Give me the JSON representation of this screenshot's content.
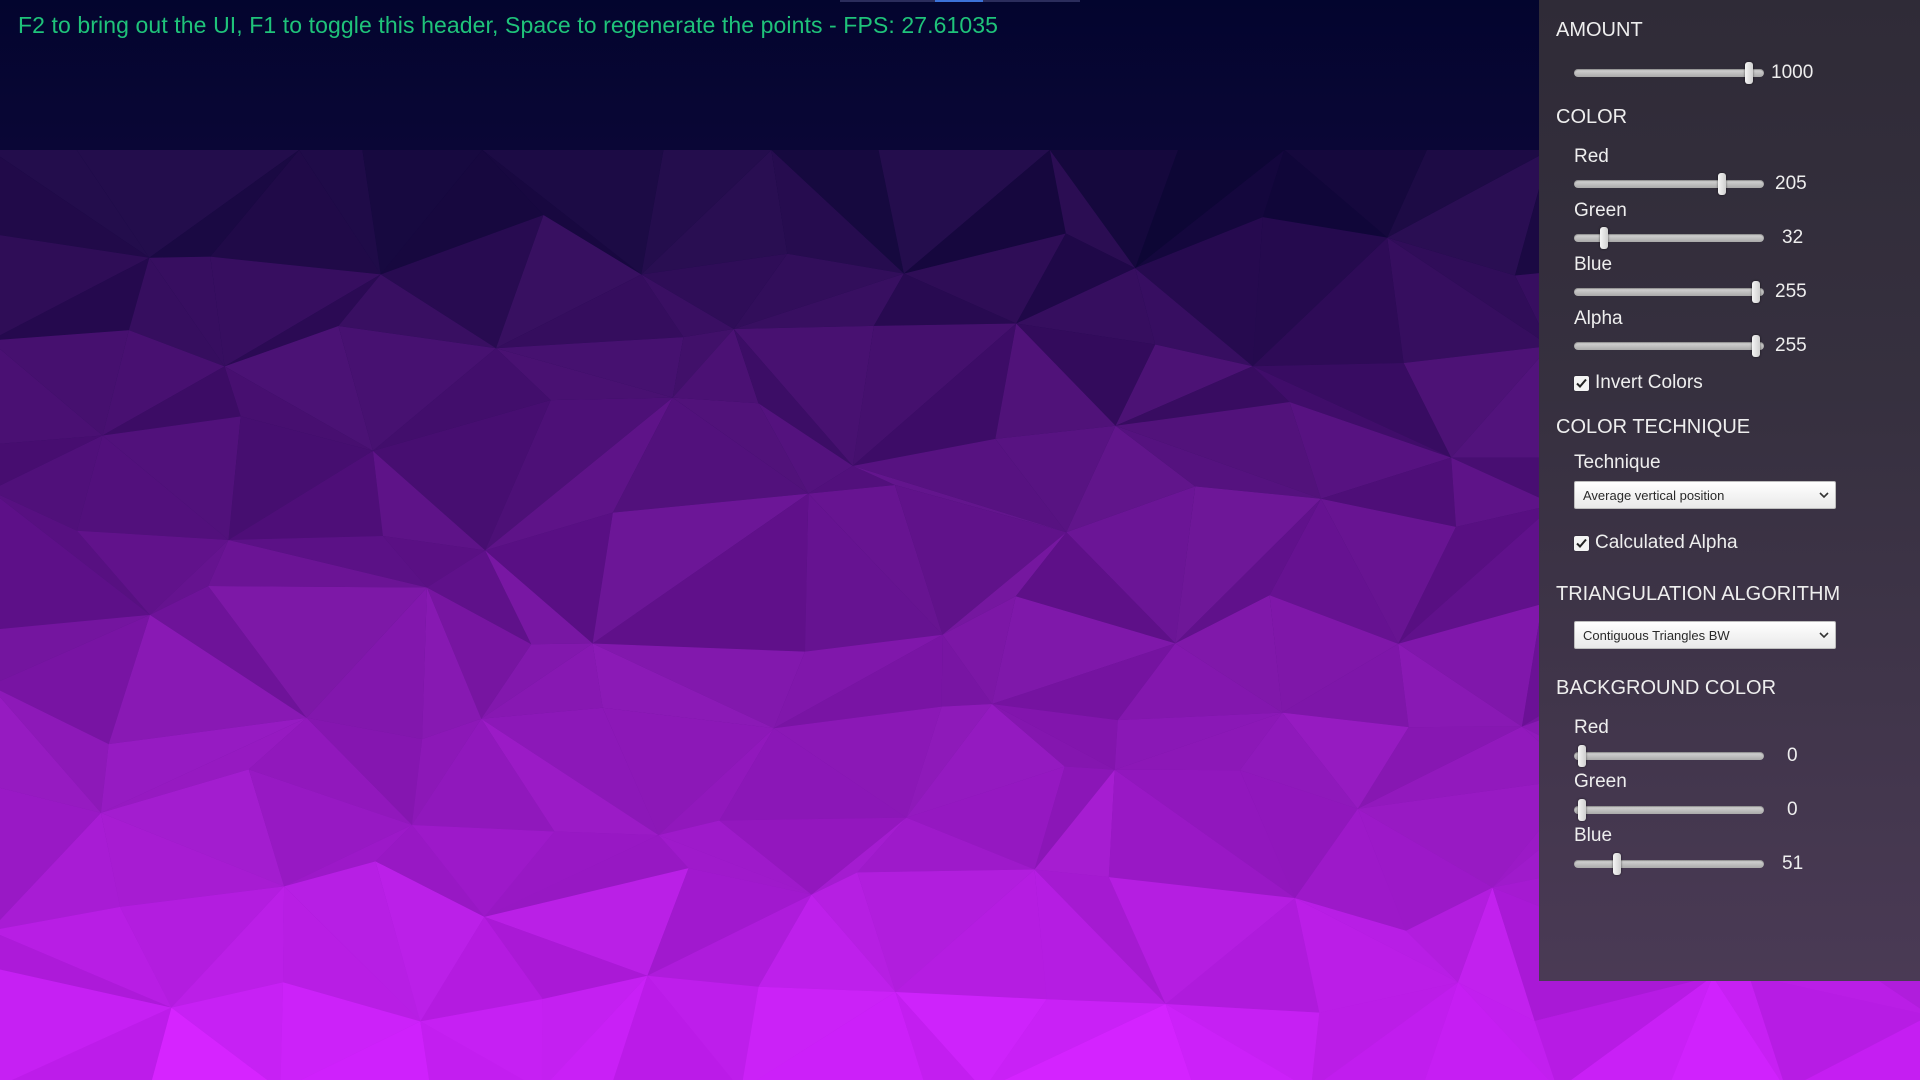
{
  "header": {
    "text": "F2 to bring out the UI, F1 to toggle this header, Space to regenerate the points -  FPS: 27.61035",
    "color": "#1fc37a"
  },
  "background": {
    "top_color": "#03052e",
    "bottom_color": "#cb1ff2"
  },
  "panel": {
    "amount": {
      "title": "AMOUNT",
      "value": 1000,
      "value_label": "1000",
      "fraction": 0.96
    },
    "color": {
      "title": "COLOR",
      "red": {
        "label": "Red",
        "value": 205,
        "value_label": "205",
        "max": 255
      },
      "green": {
        "label": "Green",
        "value": 32,
        "value_label": "32",
        "max": 255
      },
      "blue": {
        "label": "Blue",
        "value": 255,
        "value_label": "255",
        "max": 255
      },
      "alpha": {
        "label": "Alpha",
        "value": 255,
        "value_label": "255",
        "max": 255
      },
      "invert_colors": {
        "label": "Invert Colors",
        "checked": true
      }
    },
    "color_technique": {
      "title": "COLOR TECHNIQUE",
      "technique_label": "Technique",
      "technique_value": "Average vertical position",
      "calculated_alpha": {
        "label": "Calculated Alpha",
        "checked": true
      }
    },
    "triangulation": {
      "title": "TRIANGULATION ALGORITHM",
      "value": "Contiguous Triangles BW"
    },
    "background_color": {
      "title": "BACKGROUND COLOR",
      "red": {
        "label": "Red",
        "value": 0,
        "value_label": "0",
        "max": 255
      },
      "green": {
        "label": "Green",
        "value": 0,
        "value_label": "0",
        "max": 255
      },
      "blue": {
        "label": "Blue",
        "value": 51,
        "value_label": "51",
        "max": 255
      }
    }
  }
}
